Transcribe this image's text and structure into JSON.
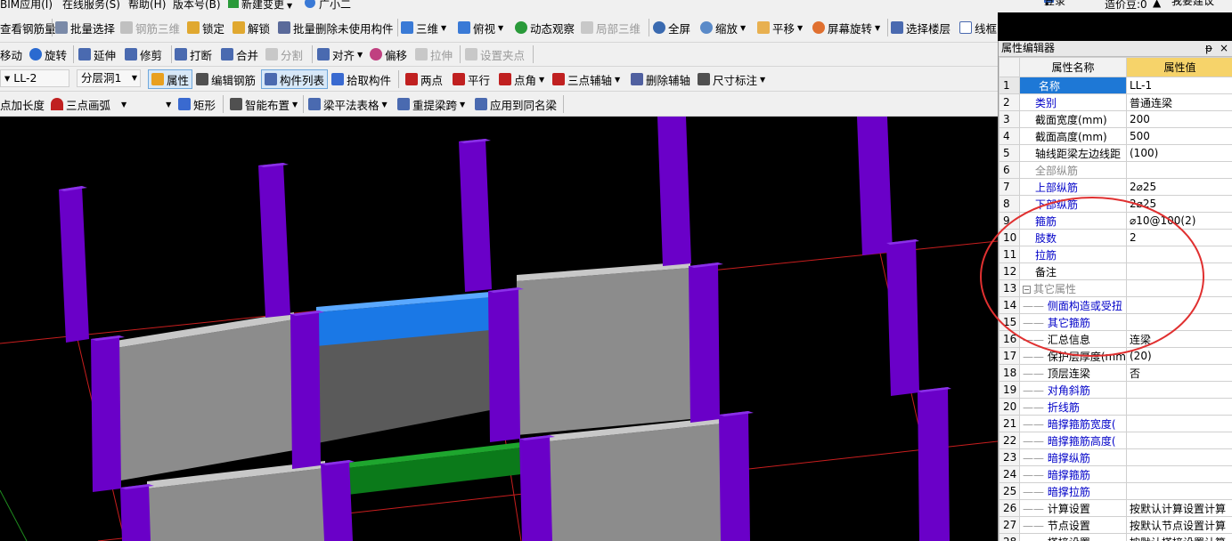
{
  "menubar": {
    "items": [
      "BIM应用(I)",
      "在线服务(S)",
      "帮助(H)",
      "版本号(B)",
      "新建变更",
      "广小二"
    ]
  },
  "topright": {
    "login": "登录",
    "points": "造价豆:0",
    "suggest": "我要建议"
  },
  "toolbar1": {
    "view_rebar_qty": "查看钢筋量",
    "batch_select": "批量选择",
    "rebar_3d": "钢筋三维",
    "lock": "锁定",
    "unlock": "解锁",
    "batch_delete": "批量删除未使用构件",
    "view_3d": "三维",
    "top_view": "俯视",
    "dynamic_view": "动态观察",
    "partial_3d": "局部三维",
    "fullscreen": "全屏",
    "zoom": "缩放",
    "pan": "平移",
    "screen_rotate": "屏幕旋转",
    "select_floor": "选择楼层",
    "wireframe": "线框"
  },
  "toolbar2": {
    "move": "移动",
    "rotate": "旋转",
    "extend": "延伸",
    "trim": "修剪",
    "break": "打断",
    "merge": "合并",
    "split": "分割",
    "align": "对齐",
    "offset": "偏移",
    "stretch": "拉伸",
    "set_grip": "设置夹点"
  },
  "toolbar3": {
    "component": "LL-2",
    "layer": "分层洞1",
    "property": "属性",
    "edit_rebar": "编辑钢筋",
    "component_list": "构件列表",
    "pick_component": "拾取构件",
    "two_points": "两点",
    "parallel": "平行",
    "point_angle": "点角",
    "three_point_axis": "三点辅轴",
    "delete_axis": "删除辅轴",
    "dimension": "尺寸标注"
  },
  "toolbar4": {
    "point_length": "点加长度",
    "three_point_arc": "三点画弧",
    "rectangle": "矩形",
    "smart_layout": "智能布置",
    "beam_table": "梁平法表格",
    "re_span": "重提梁跨",
    "apply_same_name": "应用到同名梁"
  },
  "panel": {
    "title": "属性编辑器",
    "pin": "ᵽ",
    "close": "×",
    "col_name": "属性名称",
    "col_value": "属性值",
    "rows": [
      {
        "no": "1",
        "name": "名称",
        "value": "LL-1",
        "style": "sel",
        "indent": 0
      },
      {
        "no": "2",
        "name": "类别",
        "value": "普通连梁",
        "style": "blue",
        "indent": 0
      },
      {
        "no": "3",
        "name": "截面宽度(mm)",
        "value": "200",
        "style": "black",
        "indent": 0
      },
      {
        "no": "4",
        "name": "截面高度(mm)",
        "value": "500",
        "style": "black",
        "indent": 0
      },
      {
        "no": "5",
        "name": "轴线距梁左边线距",
        "value": "(100)",
        "style": "black",
        "indent": 0
      },
      {
        "no": "6",
        "name": "全部纵筋",
        "value": "",
        "style": "grey",
        "indent": 0
      },
      {
        "no": "7",
        "name": "上部纵筋",
        "value": "2⌀25",
        "style": "blue",
        "indent": 0
      },
      {
        "no": "8",
        "name": "下部纵筋",
        "value": "2⌀25",
        "style": "blue",
        "indent": 0
      },
      {
        "no": "9",
        "name": "箍筋",
        "value": "⌀10@100(2)",
        "style": "blue",
        "indent": 0
      },
      {
        "no": "10",
        "name": "肢数",
        "value": "2",
        "style": "blue",
        "indent": 0
      },
      {
        "no": "11",
        "name": "拉筋",
        "value": "",
        "style": "blue",
        "indent": 0
      },
      {
        "no": "12",
        "name": "备注",
        "value": "",
        "style": "black",
        "indent": 0
      },
      {
        "no": "13",
        "name": "其它属性",
        "value": "",
        "style": "group",
        "indent": 0
      },
      {
        "no": "14",
        "name": "侧面构造或受扭",
        "value": "",
        "style": "blue",
        "indent": 1
      },
      {
        "no": "15",
        "name": "其它箍筋",
        "value": "",
        "style": "blue",
        "indent": 1
      },
      {
        "no": "16",
        "name": "汇总信息",
        "value": "连梁",
        "style": "black",
        "indent": 1
      },
      {
        "no": "17",
        "name": "保护层厚度(mm)",
        "value": "(20)",
        "style": "black",
        "indent": 1
      },
      {
        "no": "18",
        "name": "顶层连梁",
        "value": "否",
        "style": "black",
        "indent": 1
      },
      {
        "no": "19",
        "name": "对角斜筋",
        "value": "",
        "style": "blue",
        "indent": 1
      },
      {
        "no": "20",
        "name": "折线筋",
        "value": "",
        "style": "blue",
        "indent": 1
      },
      {
        "no": "21",
        "name": "暗撑箍筋宽度(",
        "value": "",
        "style": "blue",
        "indent": 1
      },
      {
        "no": "22",
        "name": "暗撑箍筋高度(",
        "value": "",
        "style": "blue",
        "indent": 1
      },
      {
        "no": "23",
        "name": "暗撑纵筋",
        "value": "",
        "style": "blue",
        "indent": 1
      },
      {
        "no": "24",
        "name": "暗撑箍筋",
        "value": "",
        "style": "blue",
        "indent": 1
      },
      {
        "no": "25",
        "name": "暗撑拉筋",
        "value": "",
        "style": "blue",
        "indent": 1
      },
      {
        "no": "26",
        "name": "计算设置",
        "value": "按默认计算设置计算",
        "style": "black",
        "indent": 1
      },
      {
        "no": "27",
        "name": "节点设置",
        "value": "按默认节点设置计算",
        "style": "black",
        "indent": 1
      },
      {
        "no": "28",
        "name": "搭接设置",
        "value": "按默认搭接设置计算",
        "style": "black",
        "indent": 1
      }
    ]
  },
  "colors": {
    "column": "#6a00c8",
    "wall_face": "#8c8c8c",
    "wall_top": "#c8c8c8",
    "beam_selected": "#1a78e6",
    "beam_other": "#0b7a1a",
    "grid_line": "#d21e1e",
    "annotation_circle": "#e03030",
    "selected_row": "#1e78d6",
    "header_value": "#f6d36a"
  }
}
